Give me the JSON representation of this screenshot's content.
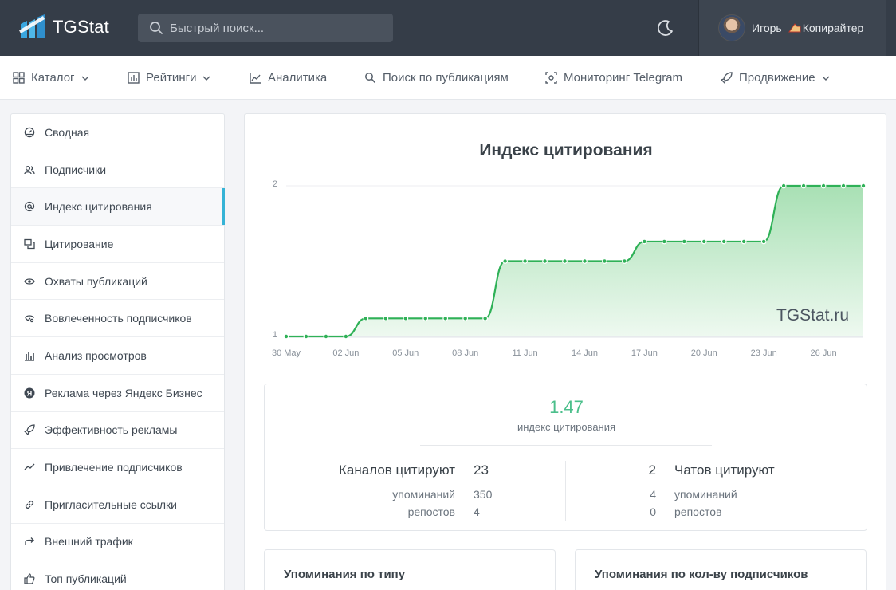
{
  "header": {
    "logo_text": "TGStat",
    "search_placeholder": "Быстрый поиск...",
    "user_name": "Игорь",
    "user_badge": "Копирайтер"
  },
  "nav": [
    {
      "label": "Каталог",
      "icon": "grid-icon",
      "dropdown": true
    },
    {
      "label": "Рейтинги",
      "icon": "bar-chart-icon",
      "dropdown": true
    },
    {
      "label": "Аналитика",
      "icon": "line-chart-icon",
      "dropdown": false
    },
    {
      "label": "Поиск по публикациям",
      "icon": "search-icon",
      "dropdown": false
    },
    {
      "label": "Мониторинг Telegram",
      "icon": "scan-icon",
      "dropdown": false
    },
    {
      "label": "Продвижение",
      "icon": "rocket-icon",
      "dropdown": true
    }
  ],
  "sidebar": [
    {
      "label": "Сводная",
      "icon": "dashboard-icon"
    },
    {
      "label": "Подписчики",
      "icon": "users-icon"
    },
    {
      "label": "Индекс цитирования",
      "icon": "at-icon",
      "active": true
    },
    {
      "label": "Цитирование",
      "icon": "quote-icon"
    },
    {
      "label": "Охваты публикаций",
      "icon": "eye-icon"
    },
    {
      "label": "Вовлеченность подписчиков",
      "icon": "engagement-icon"
    },
    {
      "label": "Анализ просмотров",
      "icon": "bars-icon"
    },
    {
      "label": "Реклама через Яндекс Бизнес",
      "icon": "yandex-icon"
    },
    {
      "label": "Эффективность рекламы",
      "icon": "rocket-icon"
    },
    {
      "label": "Привлечение подписчиков",
      "icon": "trend-icon"
    },
    {
      "label": "Пригласительные ссылки",
      "icon": "link-icon"
    },
    {
      "label": "Внешний трафик",
      "icon": "share-icon"
    },
    {
      "label": "Топ публикаций",
      "icon": "thumbs-up-icon"
    }
  ],
  "main": {
    "title": "Индекс цитирования",
    "watermark": "TGStat.ru",
    "summary": {
      "value": "1.47",
      "label": "индекс цитирования",
      "channels_label": "Каналов цитируют",
      "channels_value": "23",
      "channels_mentions_label": "упоминаний",
      "channels_mentions_value": "350",
      "channels_reposts_label": "репостов",
      "channels_reposts_value": "4",
      "chats_label": "Чатов цитируют",
      "chats_value": "2",
      "chats_mentions_label": "упоминаний",
      "chats_mentions_value": "4",
      "chats_reposts_label": "репостов",
      "chats_reposts_value": "0"
    },
    "bottom_cards": [
      "Упоминания по типу",
      "Упоминания по кол-ву подписчиков"
    ]
  },
  "colors": {
    "line": "#2fb157",
    "area_top": "#a8e0b4",
    "area_bottom": "#eef9f0",
    "accent": "#35b3d6",
    "summary_value": "#4bbf8b"
  },
  "chart_data": {
    "type": "area",
    "x": [
      "30 May",
      "31 May",
      "01 Jun",
      "02 Jun",
      "03 Jun",
      "04 Jun",
      "05 Jun",
      "06 Jun",
      "07 Jun",
      "08 Jun",
      "09 Jun",
      "10 Jun",
      "11 Jun",
      "12 Jun",
      "13 Jun",
      "14 Jun",
      "15 Jun",
      "16 Jun",
      "17 Jun",
      "18 Jun",
      "19 Jun",
      "20 Jun",
      "21 Jun",
      "22 Jun",
      "23 Jun",
      "24 Jun",
      "25 Jun",
      "26 Jun",
      "27 Jun",
      "28 Jun"
    ],
    "values": [
      1.0,
      1.0,
      1.0,
      1.0,
      1.12,
      1.12,
      1.12,
      1.12,
      1.12,
      1.12,
      1.12,
      1.5,
      1.5,
      1.5,
      1.5,
      1.5,
      1.5,
      1.5,
      1.63,
      1.63,
      1.63,
      1.63,
      1.63,
      1.63,
      1.63,
      2.0,
      2.0,
      2.0,
      2.0,
      2.0
    ],
    "xticks": [
      "30 May",
      "02 Jun",
      "05 Jun",
      "08 Jun",
      "11 Jun",
      "14 Jun",
      "17 Jun",
      "20 Jun",
      "23 Jun",
      "26 Jun"
    ],
    "yticks": [
      "1",
      "2"
    ],
    "ylim": [
      1,
      2
    ],
    "title": "Индекс цитирования",
    "grid": true
  }
}
